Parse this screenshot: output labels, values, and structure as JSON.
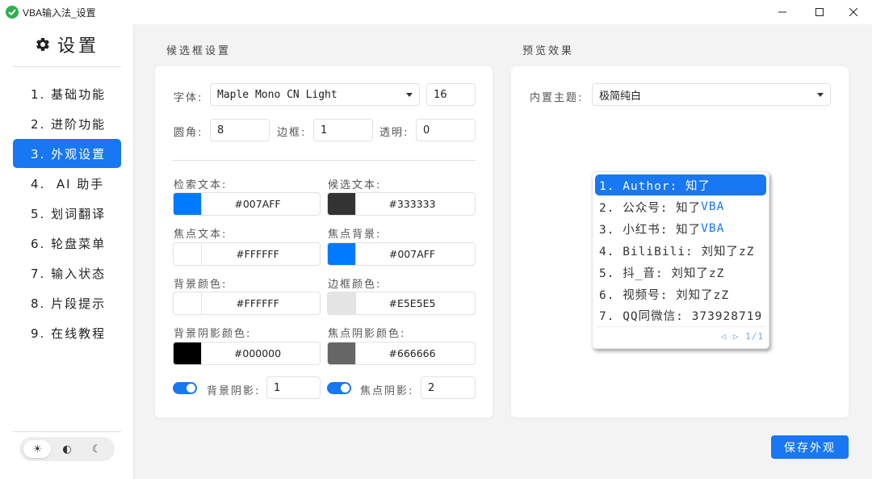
{
  "window": {
    "title": "VBA输入法_设置",
    "min_icon": "minimize-icon",
    "max_icon": "maximize-icon",
    "close_icon": "close-icon"
  },
  "sidebar": {
    "title": "设置",
    "title_icon": "gear-icon",
    "items": [
      {
        "label": "1. 基础功能"
      },
      {
        "label": "2. 进阶功能"
      },
      {
        "label": "3. 外观设置",
        "active": true
      },
      {
        "label": "4.  AI 助手"
      },
      {
        "label": "5. 划词翻译"
      },
      {
        "label": "6. 轮盘菜单"
      },
      {
        "label": "7. 输入状态"
      },
      {
        "label": "8. 片段提示"
      },
      {
        "label": "9. 在线教程"
      }
    ],
    "theme_modes": [
      {
        "icon": "sun-icon",
        "glyph": "☀",
        "active": true
      },
      {
        "icon": "contrast-icon",
        "glyph": "◐"
      },
      {
        "icon": "moon-icon",
        "glyph": "☾"
      }
    ]
  },
  "candidate_settings": {
    "section_title": "候选框设置",
    "font_label": "字体:",
    "font_value": "Maple Mono CN Light",
    "font_size": "16",
    "radius_label": "圆角:",
    "radius_value": "8",
    "border_label": "边框:",
    "border_value": "1",
    "opacity_label": "透明:",
    "opacity_value": "0",
    "search_text_label": "检索文本:",
    "search_text_color": "#007AFF",
    "candidate_text_label": "候选文本:",
    "candidate_text_color": "#333333",
    "focus_text_label": "焦点文本:",
    "focus_text_color": "#FFFFFF",
    "focus_bg_label": "焦点背景:",
    "focus_bg_color": "#007AFF",
    "bg_color_label": "背景颜色:",
    "bg_color": "#FFFFFF",
    "border_color_label": "边框颜色:",
    "border_color": "#E5E5E5",
    "bg_shadow_color_label": "背景阴影颜色:",
    "bg_shadow_color": "#000000",
    "focus_shadow_color_label": "焦点阴影颜色:",
    "focus_shadow_color": "#666666",
    "bg_shadow_label": "背景阴影:",
    "bg_shadow_enabled": true,
    "bg_shadow_value": "1",
    "focus_shadow_label": "焦点阴影:",
    "focus_shadow_enabled": true,
    "focus_shadow_value": "2"
  },
  "preview": {
    "section_title": "预览效果",
    "theme_label": "内置主题:",
    "theme_value": "极简纯白",
    "candidates": [
      {
        "text": "1. Author: 知了",
        "vba": "",
        "focus": true
      },
      {
        "text": "2. 公众号: 知了",
        "vba": "VBA"
      },
      {
        "text": "3. 小红书: 知了",
        "vba": "VBA"
      },
      {
        "text": "4. BiliBili: 刘知了zZ",
        "vba": ""
      },
      {
        "text": "5. 抖_音: 刘知了zZ",
        "vba": ""
      },
      {
        "text": "6. 视频号: 刘知了zZ",
        "vba": ""
      },
      {
        "text": "7. QQ同微信: 373928719",
        "vba": ""
      }
    ],
    "pager": "◁ ▷ 1/1"
  },
  "actions": {
    "save_label": "保存外观"
  }
}
